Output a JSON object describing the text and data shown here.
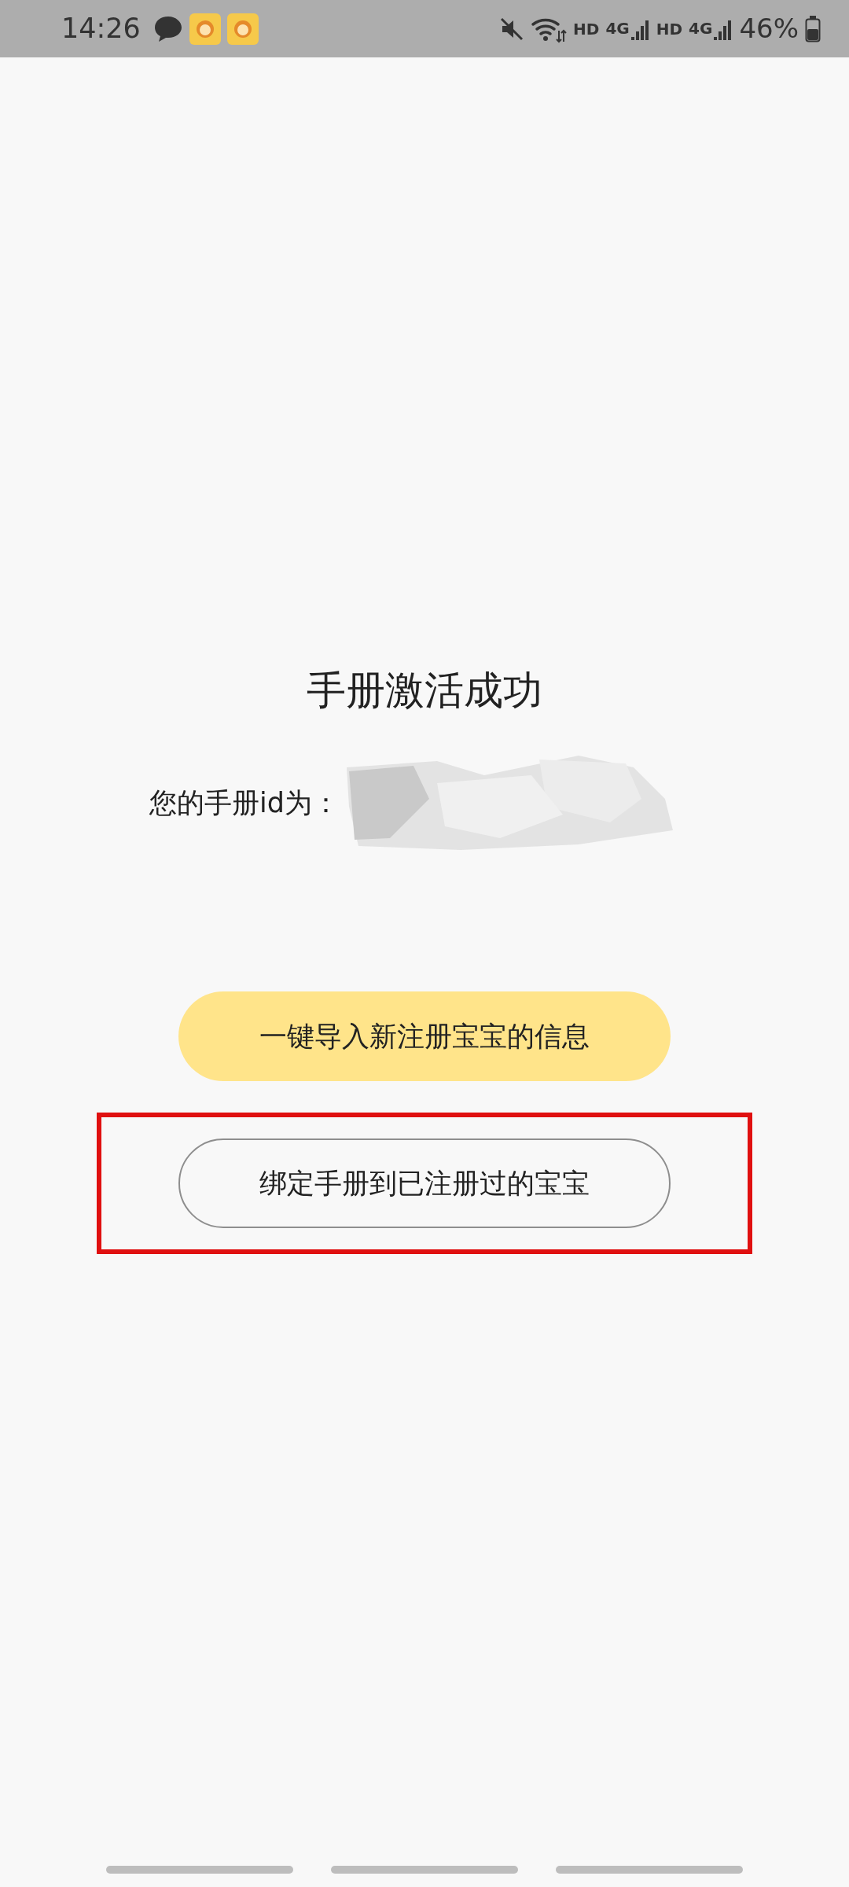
{
  "status_bar": {
    "time": "14:26",
    "hd_labels": [
      "HD",
      "HD"
    ],
    "network_labels": [
      "4G",
      "4G"
    ],
    "battery": "46%"
  },
  "title": "手册激活成功",
  "id_label": "您的手册id为：",
  "buttons": [
    {
      "label": "一键导入新注册宝宝的信息",
      "kind": "primary",
      "highlighted": false
    },
    {
      "label": "绑定手册到已注册过的宝宝",
      "kind": "outline",
      "highlighted": true
    }
  ]
}
